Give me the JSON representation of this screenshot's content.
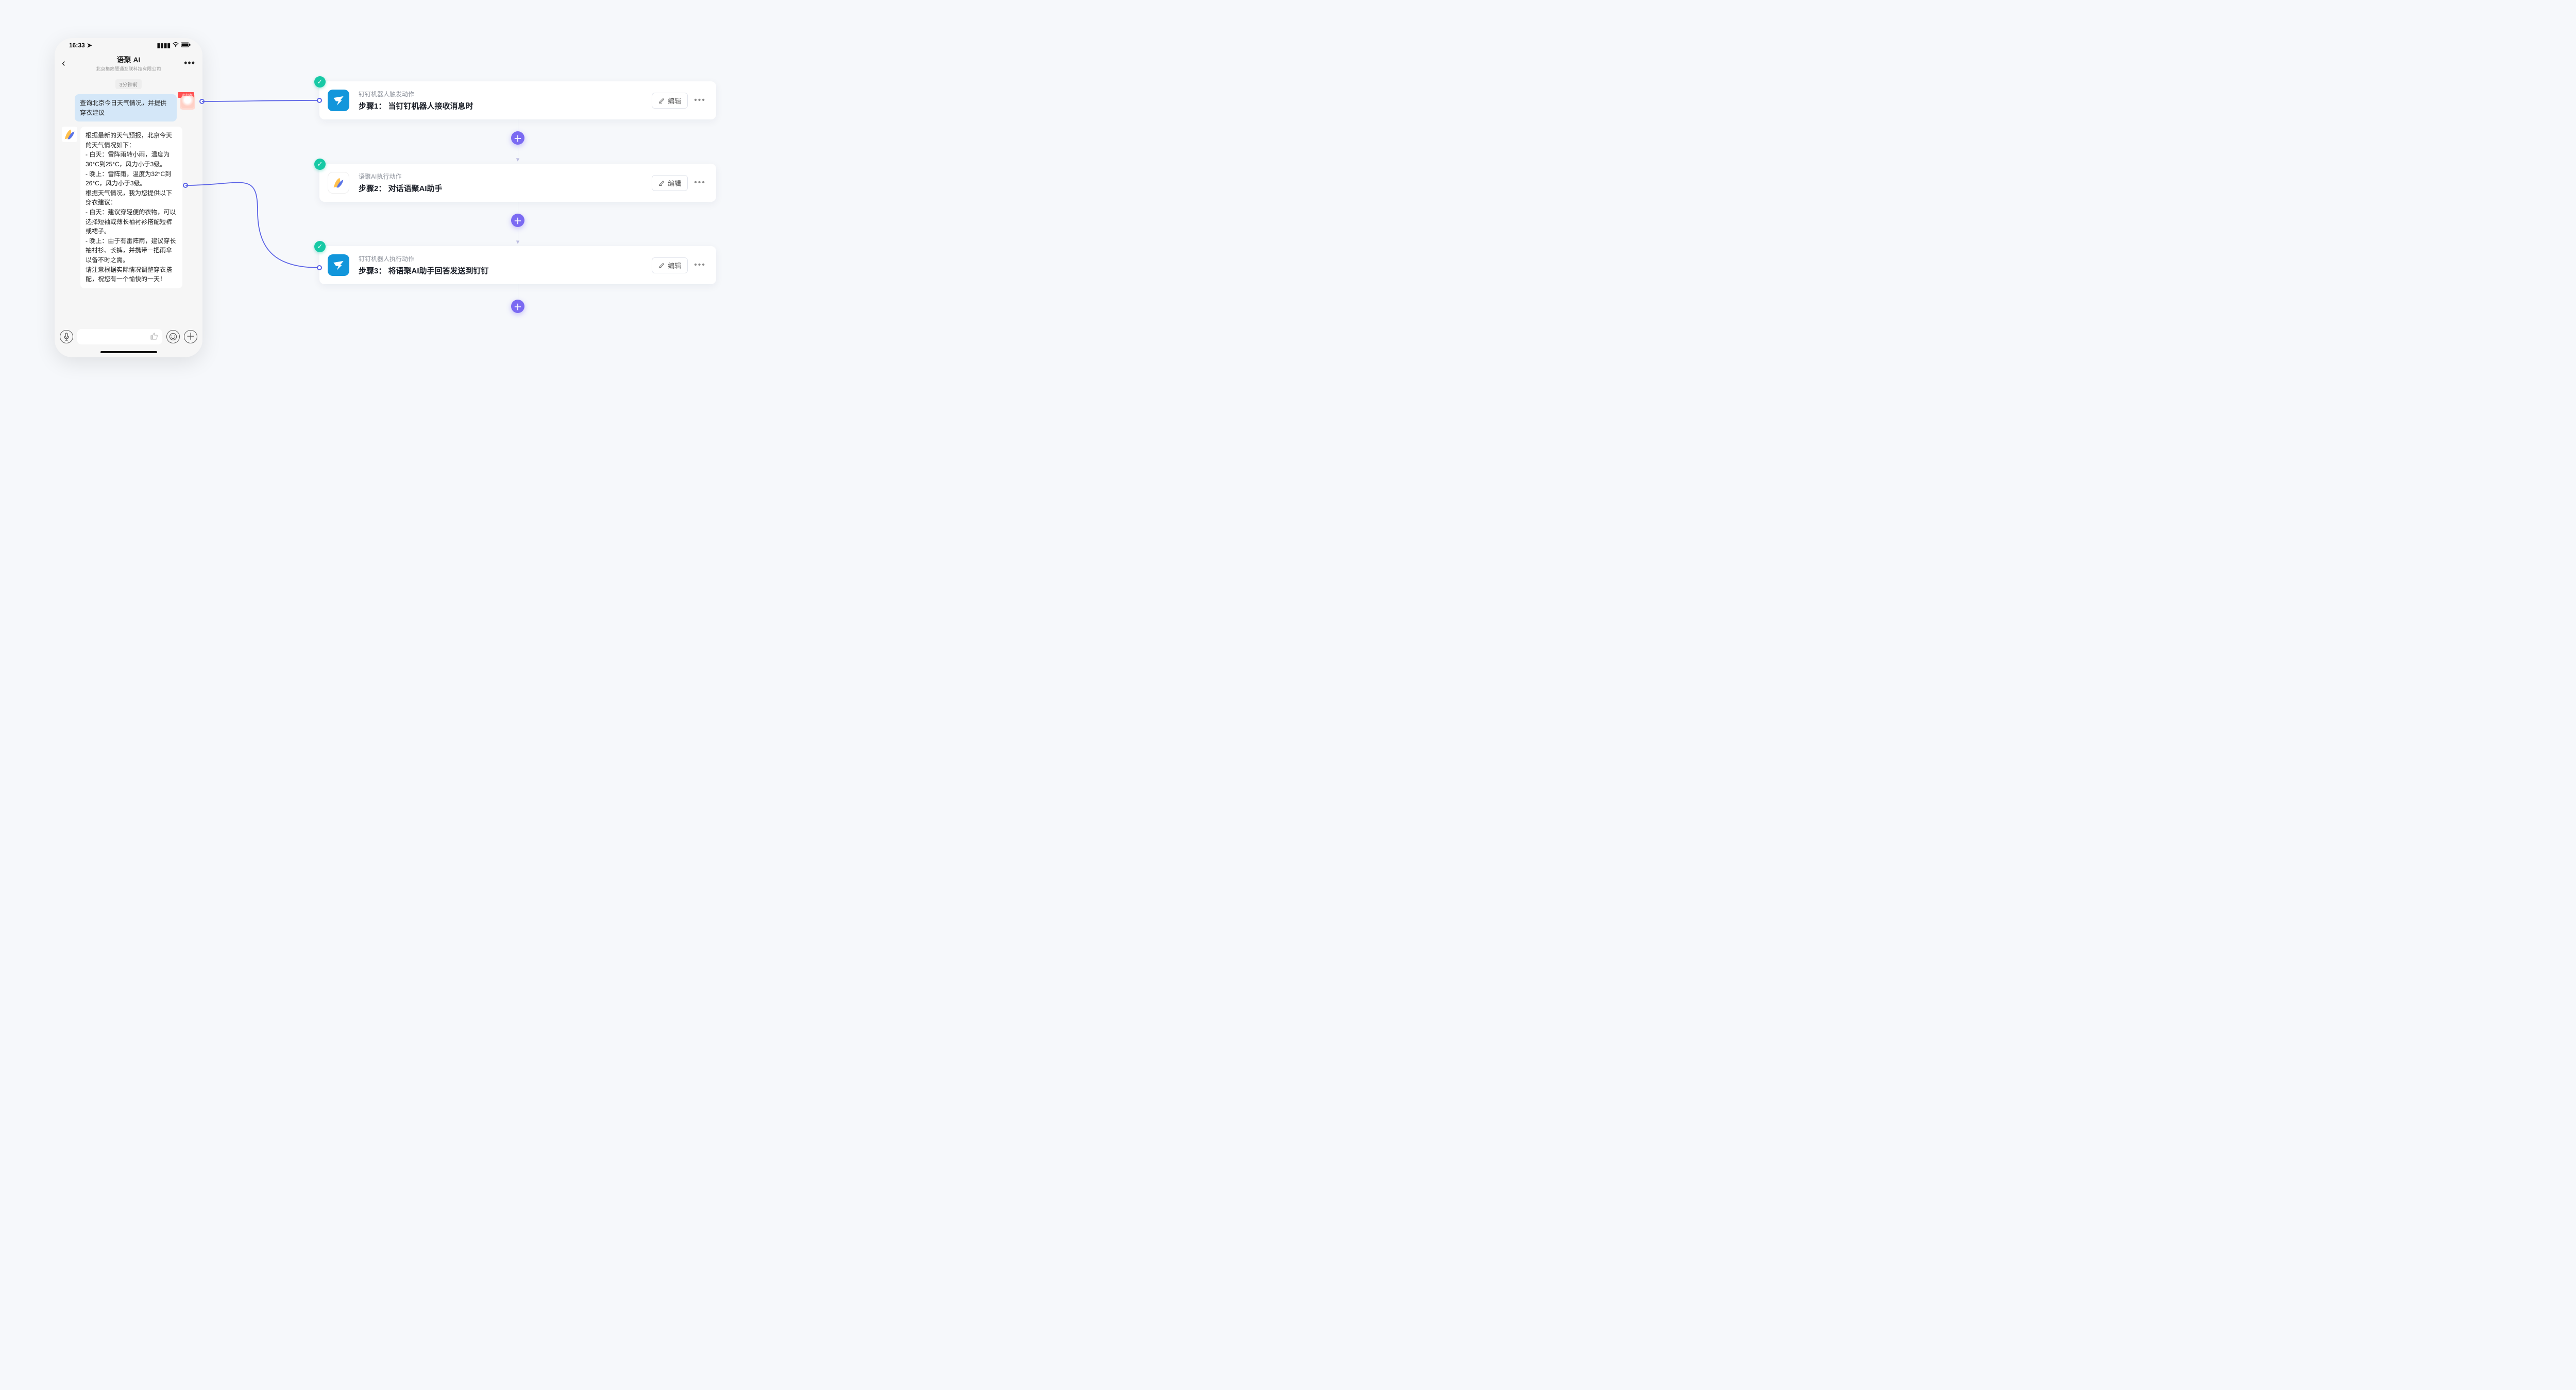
{
  "phone": {
    "status_time": "16:33",
    "nav_title": "语聚 AI",
    "nav_subtitle": "北京集简慧通互联科技有限公司",
    "timestamp": "3分钟前",
    "user_message": "查询北京今日天气情况，并提供穿衣建议",
    "user_avatar_badge": "一起加油!",
    "bot_message": "根据最新的天气预报，北京今天的天气情况如下：\n- 白天：雷阵雨转小雨，温度为30°C到25°C，风力小于3级。\n- 晚上：雷阵雨，温度为32°C到26°C，风力小于3级。\n根据天气情况，我为您提供以下穿衣建议：\n- 白天：建议穿轻便的衣物，可以选择短袖或薄长袖衬衫搭配短裤或裙子。\n- 晚上：由于有雷阵雨，建议穿长袖衬衫、长裤，并携带一把雨伞以备不时之需。\n请注意根据实际情况调整穿衣搭配，祝您有一个愉快的一天！"
  },
  "flow": {
    "edit_label": "编辑",
    "steps": [
      {
        "icon": "ding",
        "subtitle": "钉钉机器人触发动作",
        "title": "步骤1： 当钉钉机器人接收消息时"
      },
      {
        "icon": "yuju",
        "subtitle": "语聚AI执行动作",
        "title": "步骤2： 对话语聚AI助手"
      },
      {
        "icon": "ding",
        "subtitle": "钉钉机器人执行动作",
        "title": "步骤3： 将语聚AI助手回答发送到钉钉"
      }
    ]
  }
}
